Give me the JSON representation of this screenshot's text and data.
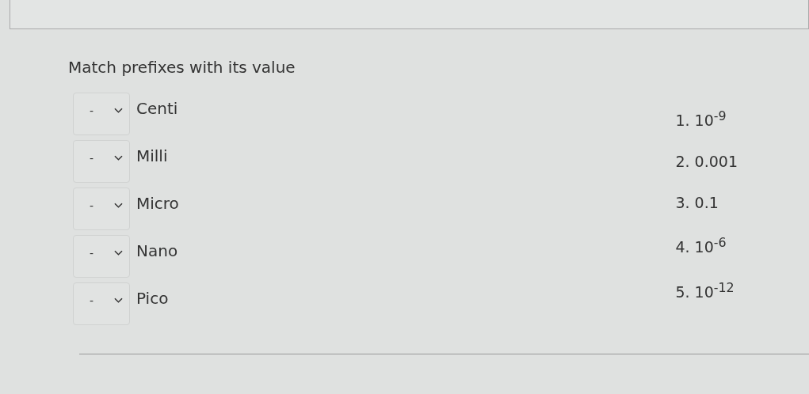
{
  "question": "Match prefixes with its value",
  "items": [
    {
      "selected_value": "-",
      "label": "Centi"
    },
    {
      "selected_value": "-",
      "label": "Milli"
    },
    {
      "selected_value": "-",
      "label": "Micro"
    },
    {
      "selected_value": "-",
      "label": "Nano"
    },
    {
      "selected_value": "-",
      "label": "Pico"
    }
  ],
  "answers": [
    "1. 10$^{-9}$",
    "2. 0.001",
    "3. 0.1",
    "4. 10$^{-6}$",
    "5. 10$^{-12}$"
  ]
}
